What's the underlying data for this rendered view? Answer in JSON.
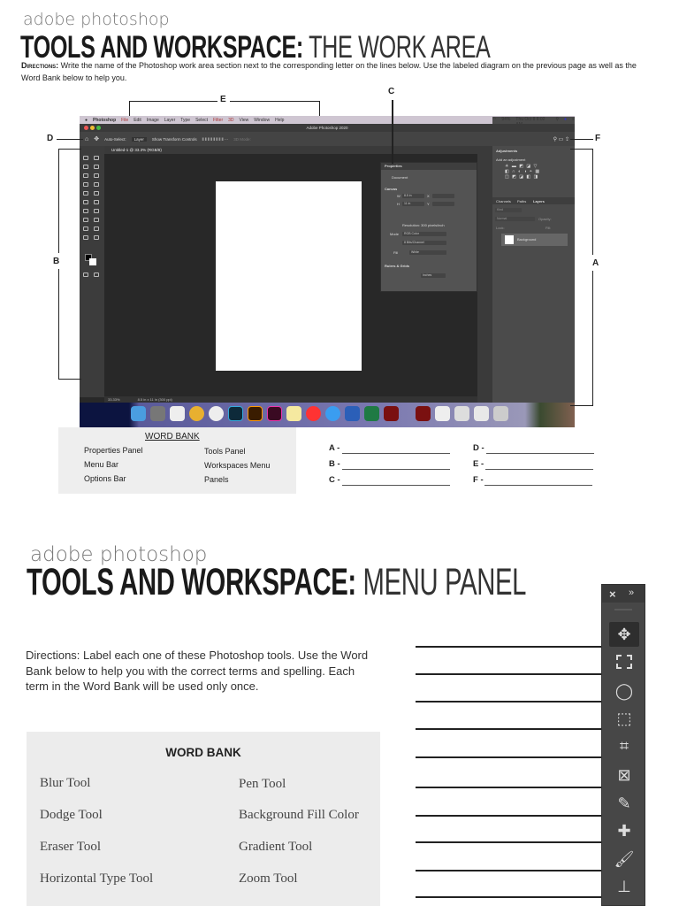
{
  "page1": {
    "brand": "adobe photoshop",
    "title_bold": "TOOLS AND WORKSPACE:",
    "title_light": " THE WORK AREA",
    "directions_label": "Directions:",
    "directions_text": " Write the name of the Photoshop work area section next to the corresponding letter on the lines below.  Use the labeled diagram on the previous page as well as the Word Bank below to help you.",
    "diagram_labels": {
      "A": "A",
      "B": "B",
      "C": "C",
      "D": "D",
      "E": "E",
      "F": "F"
    },
    "screenshot": {
      "menu_items": [
        "Photoshop",
        "File",
        "Edit",
        "Image",
        "Layer",
        "Type",
        "Select",
        "Filter",
        "3D",
        "View",
        "Window",
        "Help"
      ],
      "battery": "94%",
      "clock": "Thu Oct 8  8:02 AM",
      "window_title": "Adobe Photoshop 2020",
      "options": {
        "auto_select": "Auto-Select:",
        "layer": "Layer",
        "transform": "Show Transform Controls",
        "mode_3d": "3D Mode:"
      },
      "doc_tab": "Untitled-1 @ 33.3% (RGB/8)",
      "status_zoom": "33.33%",
      "status_size": "8.5 in x 11 in (300 ppi)",
      "properties": {
        "title": "Properties",
        "document": "Document",
        "canvas": "Canvas",
        "w_label": "W",
        "w_value": "8.5 in",
        "h_label": "H",
        "h_value": "11 in",
        "x_label": "X",
        "y_label": "Y",
        "resolution": "Resolution: 300 pixels/inch",
        "mode_label": "Mode",
        "mode_value": "RGB Color",
        "bits": "8 Bits/Channel",
        "fill_label": "Fill",
        "fill_value": "White",
        "rulers": "Rulers & Grids",
        "units": "Inches"
      },
      "adjustments": {
        "title": "Adjustments",
        "subtitle": "Add an adjustment"
      },
      "layer_tabs": [
        "Channels",
        "Paths",
        "Layers"
      ],
      "layers": {
        "kind": "Kind",
        "blend": "Normal",
        "opacity": "Opacity:",
        "lock": "Lock:",
        "fill": "Fill:",
        "layer_name": "Background"
      }
    },
    "word_bank": {
      "title": "WORD BANK",
      "items": [
        "Properties Panel",
        "Tools Panel",
        "Menu Bar",
        "Workspaces Menu",
        "Options Bar",
        "Panels"
      ]
    },
    "answers": [
      "A -",
      "B -",
      "C -",
      "D -",
      "E -",
      "F -"
    ]
  },
  "page2": {
    "brand": "adobe photoshop",
    "title_bold": "TOOLS AND WORKSPACE:",
    "title_light": " MENU PANEL",
    "directions": "Directions: Label each one of these Photoshop tools. Use the Word Bank below to help you with the correct terms and spelling. Each term in the Word Bank will be used only once.",
    "word_bank": {
      "title": "WORD BANK",
      "items": [
        "Blur Tool",
        "Pen Tool",
        "Dodge Tool",
        "Background Fill Color",
        "Eraser Tool",
        "Gradient Tool",
        "Horizontal Type Tool",
        "Zoom Tool"
      ]
    },
    "toolbar": {
      "close": "×",
      "expand": "»",
      "tools": [
        "move-tool",
        "rectangular-marquee-tool",
        "lasso-tool",
        "object-selection-tool",
        "crop-tool",
        "frame-tool",
        "eyedropper-tool",
        "spot-healing-brush-tool",
        "brush-tool",
        "clone-stamp-tool"
      ]
    }
  }
}
